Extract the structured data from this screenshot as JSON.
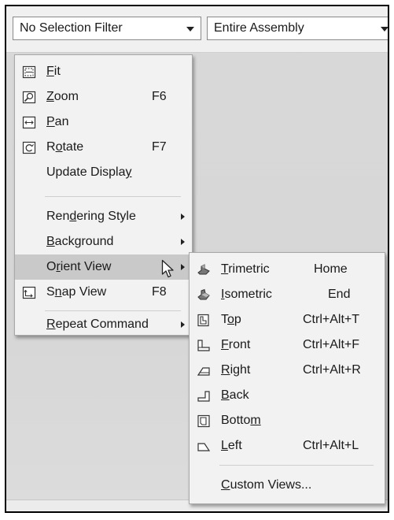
{
  "toolbar": {
    "selection_filter": "No Selection Filter",
    "scope": "Entire Assembly"
  },
  "context_menu": {
    "items": [
      {
        "pre": "",
        "u": "F",
        "post": "it",
        "shortcut": "",
        "icon": "fit-icon"
      },
      {
        "pre": "",
        "u": "Z",
        "post": "oom",
        "shortcut": "F6",
        "icon": "zoom-icon"
      },
      {
        "pre": "",
        "u": "P",
        "post": "an",
        "shortcut": "",
        "icon": "pan-icon"
      },
      {
        "pre": "R",
        "u": "o",
        "post": "tate",
        "shortcut": "F7",
        "icon": "rotate-icon"
      },
      {
        "pre": "Update Displa",
        "u": "y",
        "post": "",
        "shortcut": ""
      },
      {
        "pre": "Ren",
        "u": "d",
        "post": "ering Style",
        "shortcut": ""
      },
      {
        "pre": "",
        "u": "B",
        "post": "ackground",
        "shortcut": ""
      },
      {
        "pre": "O",
        "u": "r",
        "post": "ient View",
        "shortcut": ""
      },
      {
        "pre": "S",
        "u": "n",
        "post": "ap View",
        "shortcut": "F8",
        "icon": "snap-view-icon"
      },
      {
        "pre": "",
        "u": "R",
        "post": "epeat Command",
        "shortcut": ""
      }
    ]
  },
  "orient_submenu": {
    "items": [
      {
        "pre": "",
        "u": "T",
        "post": "rimetric",
        "shortcut": "Home",
        "icon": "trimetric-icon"
      },
      {
        "pre": "",
        "u": "I",
        "post": "sometric",
        "shortcut": "End",
        "icon": "isometric-icon"
      },
      {
        "pre": "T",
        "u": "o",
        "post": "p",
        "shortcut": "Ctrl+Alt+T",
        "icon": "top-view-icon"
      },
      {
        "pre": "",
        "u": "F",
        "post": "ront",
        "shortcut": "Ctrl+Alt+F",
        "icon": "front-view-icon"
      },
      {
        "pre": "",
        "u": "R",
        "post": "ight",
        "shortcut": "Ctrl+Alt+R",
        "icon": "right-view-icon"
      },
      {
        "pre": "",
        "u": "B",
        "post": "ack",
        "shortcut": "",
        "icon": "back-view-icon"
      },
      {
        "pre": "Botto",
        "u": "m",
        "post": "",
        "shortcut": "",
        "icon": "bottom-view-icon"
      },
      {
        "pre": "",
        "u": "L",
        "post": "eft",
        "shortcut": "Ctrl+Alt+L",
        "icon": "left-view-icon"
      },
      {
        "pre": "",
        "u": "C",
        "post": "ustom Views...",
        "shortcut": ""
      }
    ]
  }
}
